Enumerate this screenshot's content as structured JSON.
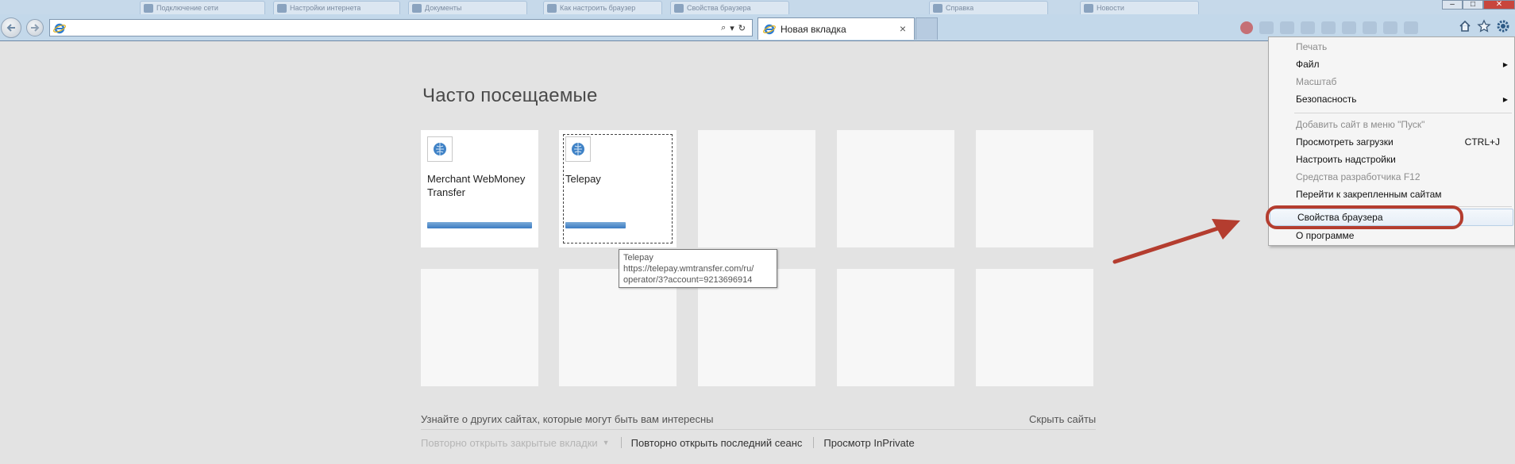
{
  "window": {
    "background_tabs": [
      {
        "label": "Подключение сети"
      },
      {
        "label": "Настройки интернета"
      },
      {
        "label": "Документы"
      },
      {
        "label": "Как настроить браузер"
      },
      {
        "label": "Свойства браузера"
      },
      {
        "label": "Справка"
      },
      {
        "label": "Новости"
      }
    ],
    "controls": {
      "minimize": "–",
      "maximize": "□",
      "close": "✕"
    }
  },
  "navbar": {
    "address_value": "",
    "address_actions": {
      "search": "⌕",
      "dropdown": "▾",
      "refresh": "↻"
    },
    "active_tab_label": "Новая вкладка",
    "tab_close": "×"
  },
  "new_tab_page": {
    "title": "Часто посещаемые",
    "tiles": [
      {
        "name": "Merchant WebMoney Transfer",
        "bar": 0.98
      },
      {
        "name": "Telepay",
        "bar": 0.51
      }
    ],
    "tooltip": {
      "title": "Telepay",
      "url_line1": "https://telepay.wmtransfer.com/ru/",
      "url_line2": "operator/3?account=9213696914"
    },
    "suggest_text": "Узнайте о других сайтах, которые могут быть вам интересны",
    "hide_sites": "Скрыть сайты",
    "bottom_links": {
      "reopen_tabs": "Повторно открыть закрытые вкладки",
      "reopen_session": "Повторно открыть последний сеанс",
      "inprivate": "Просмотр InPrivate"
    }
  },
  "tools_menu": {
    "items": [
      {
        "label": "Печать",
        "disabled": true
      },
      {
        "label": "Файл",
        "submenu": true
      },
      {
        "label": "Масштаб",
        "disabled": true
      },
      {
        "label": "Безопасность",
        "submenu": true
      },
      {
        "label": "Добавить сайт в меню \"Пуск\"",
        "disabled": true
      },
      {
        "label": "Просмотреть загрузки",
        "shortcut": "CTRL+J"
      },
      {
        "label": "Настроить надстройки"
      },
      {
        "label": "Средства разработчика F12",
        "disabled": true
      },
      {
        "label": "Перейти к закрепленным сайтам"
      },
      {
        "label": "Свойства браузера",
        "highlighted": true
      },
      {
        "label": "О программе"
      }
    ],
    "submenu_arrow": "▶"
  },
  "colors": {
    "accent_annotation": "#b43d2f",
    "progress_bar": "#3d7cc2"
  }
}
